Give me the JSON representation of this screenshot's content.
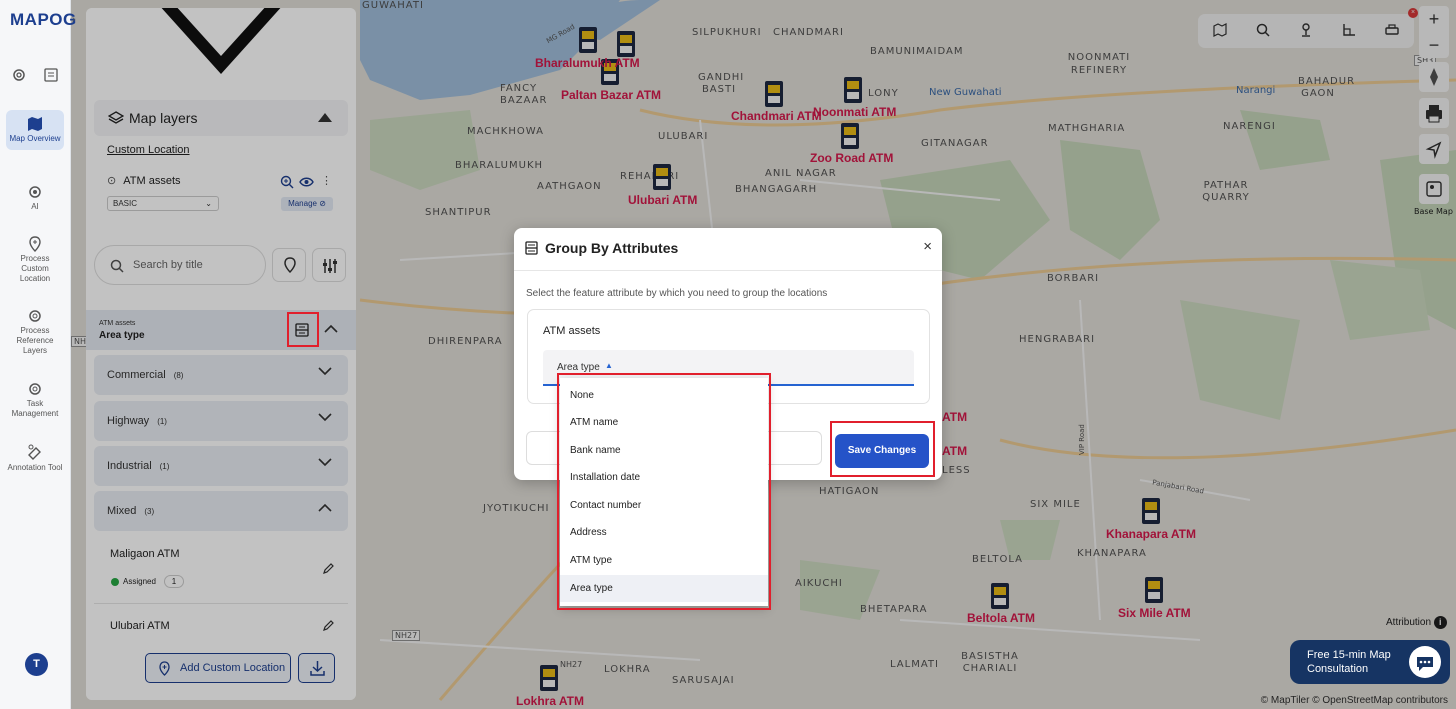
{
  "app": {
    "logo": "MAPOG"
  },
  "rail": {
    "items": [
      {
        "label": "Map Overview",
        "icon": "map-icon"
      },
      {
        "label": "AI",
        "icon": "ai-gear-icon"
      },
      {
        "label": "Process Custom Location",
        "icon": "location-pin-icon"
      },
      {
        "label": "Process Reference Layers",
        "icon": "layers-gear-icon"
      },
      {
        "label": "Task Management",
        "icon": "task-gear-icon"
      },
      {
        "label": "Annotation Tool",
        "icon": "annotation-icon"
      }
    ],
    "avatar": "T"
  },
  "panel": {
    "map_layers_title": "Map layers",
    "custom_location_link": "Custom Location",
    "layer_name": "ATM assets",
    "style_select": "BASIC",
    "manage_label": "Manage",
    "search_placeholder": "Search by title",
    "group_layer": "ATM assets",
    "group_attribute": "Area type",
    "categories": [
      {
        "name": "Commercial",
        "count": "(8)"
      },
      {
        "name": "Highway",
        "count": "(1)"
      },
      {
        "name": "Industrial",
        "count": "(1)"
      },
      {
        "name": "Mixed",
        "count": "(3)"
      }
    ],
    "locations": [
      {
        "name": "Maligaon ATM",
        "status": "Assigned",
        "count": "1"
      },
      {
        "name": "Ulubari ATM"
      }
    ],
    "add_button": "Add Custom Location"
  },
  "modal": {
    "title": "Group By Attributes",
    "close": "×",
    "description": "Select the feature attribute by which you need to group the locations",
    "field_title": "ATM assets",
    "select_value": "Area type",
    "save_label": "Save Changes"
  },
  "dropdown": {
    "options": [
      "None",
      "ATM name",
      "Bank name",
      "Installation date",
      "Contact number",
      "Address",
      "ATM type",
      "Area type"
    ],
    "selected": "Area type"
  },
  "map": {
    "place_labels": [
      "GUWAHATI",
      "SILPUKHURI",
      "CHANDMARI",
      "BAMUNIMAIDAM",
      "NOONMATI REFINERY",
      "FANCY BAZAAR",
      "GANDHI BASTI",
      "LONY",
      "New Guwahati",
      "Narangi",
      "BAHADUR GAON",
      "MACHKHOWA",
      "ULUBARI",
      "GITANAGAR",
      "MATHGHARIA",
      "NARENGI",
      "BHARALUMUKH",
      "AATHGAON",
      "REHABARI",
      "ANIL NAGAR",
      "BHANGAGARH",
      "SHANTIPUR",
      "PATHAR QUARRY",
      "BORBARI",
      "HENGRABARI",
      "DHIRENPARA",
      "HATIGAON",
      "SIX MILE",
      "JYOTIKUCHI",
      "KHANAPARA",
      "BELTOLA",
      "BHETAPARA",
      "BASISTHA CHARIALI",
      "LALMATI",
      "LOKHRA",
      "SARUSAJAI",
      "AIKUCHI",
      "LESS",
      "NH27",
      "NH27",
      "VIP Road",
      "Panjabari Road",
      "MG Road",
      "NH",
      "SH3"
    ],
    "atm_labels": [
      "Bharalumukh ATM",
      "Paltan Bazar ATM",
      "Chandmari ATM",
      "Noonmati ATM",
      "Zoo Road ATM",
      "Ulubari ATM",
      "Khanapara ATM",
      "Six Mile ATM",
      "Beltola ATM",
      "Lokhra ATM",
      "ATM",
      "ATM"
    ],
    "base_map_label": "Base Map",
    "attribution_label": "Attribution",
    "credits": "© MapTiler © OpenStreetMap contributors"
  },
  "consult": {
    "line1": "Free 15-min Map",
    "line2": "Consultation"
  },
  "colors": {
    "brand": "#1d3f8f",
    "atm_label": "#e01a4f",
    "highlight": "#e11f2c",
    "save_button": "#2553c8"
  }
}
